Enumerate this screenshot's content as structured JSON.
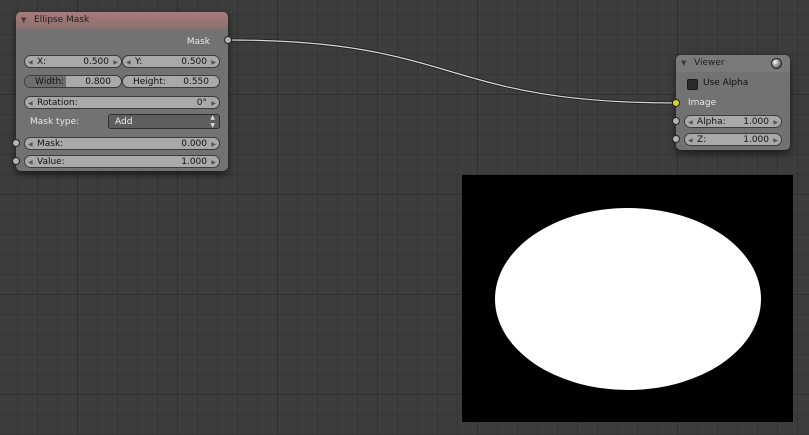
{
  "mask_node": {
    "title": "Ellipse Mask",
    "output_label": "Mask",
    "x": {
      "label": "X:",
      "value": "0.500"
    },
    "y": {
      "label": "Y:",
      "value": "0.500"
    },
    "width": {
      "label": "Width:",
      "value": "0.800"
    },
    "height": {
      "label": "Height:",
      "value": "0.550"
    },
    "rotation": {
      "label": "Rotation:",
      "value": "0°"
    },
    "mask_type": {
      "label": "Mask type:",
      "value": "Add"
    },
    "mask": {
      "label": "Mask:",
      "value": "0.000"
    },
    "value": {
      "label": "Value:",
      "value": "1.000"
    }
  },
  "viewer_node": {
    "title": "Viewer",
    "use_alpha_label": "Use Alpha",
    "image_label": "Image",
    "alpha": {
      "label": "Alpha:",
      "value": "1.000"
    },
    "z": {
      "label": "Z:",
      "value": "1.000"
    }
  },
  "colors": {
    "mask_header": "#a87c7c",
    "image_socket": "#d6d62a",
    "background": "#3d3d3d"
  }
}
